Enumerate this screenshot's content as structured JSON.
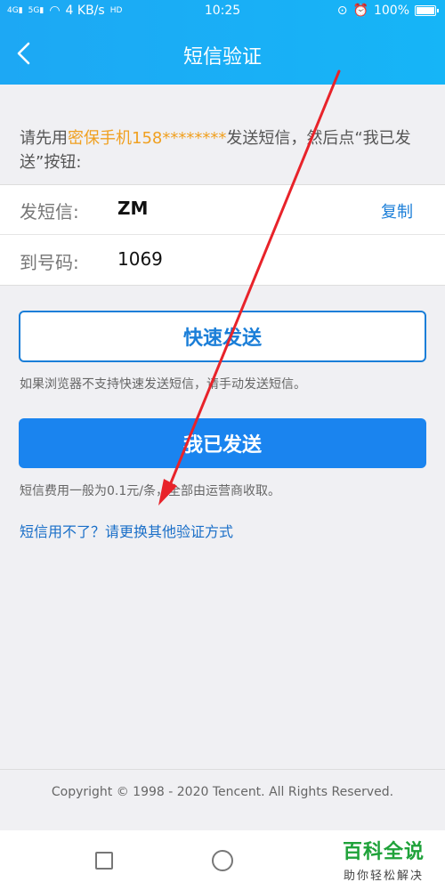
{
  "status_bar": {
    "signal1": "4G",
    "signal2": "5G",
    "speed": "4 KB/s",
    "hd": "HD",
    "time": "10:25",
    "battery": "100%"
  },
  "header": {
    "title": "短信验证"
  },
  "instruction": {
    "prefix": "请先用",
    "highlight": "密保手机158********",
    "suffix": "发送短信，然后点“我已发送”按钮:"
  },
  "info": {
    "send_label": "发短信:",
    "send_value": "ZM",
    "copy_label": "复制",
    "to_label": "到号码:",
    "to_value": "1069"
  },
  "buttons": {
    "quick_send": "快速发送",
    "already_sent": "我已发送"
  },
  "hints": {
    "quick_hint": "如果浏览器不支持快速发送短信，请手动发送短信。",
    "fee_hint": "短信费用一般为0.1元/条，全部由运营商收取。"
  },
  "alt_link": "短信用不了？请更换其他验证方式",
  "footer": {
    "copyright": "Copyright © 1998 - 2020 Tencent. All Rights Reserved."
  },
  "watermark": {
    "title": "百科全说",
    "subtitle": "助你轻松解决"
  },
  "colors": {
    "header": "#1da8f4",
    "primary_button": "#1a84ef",
    "link": "#1a7ed8",
    "highlight": "#f0a020",
    "arrow": "#e8232a"
  }
}
